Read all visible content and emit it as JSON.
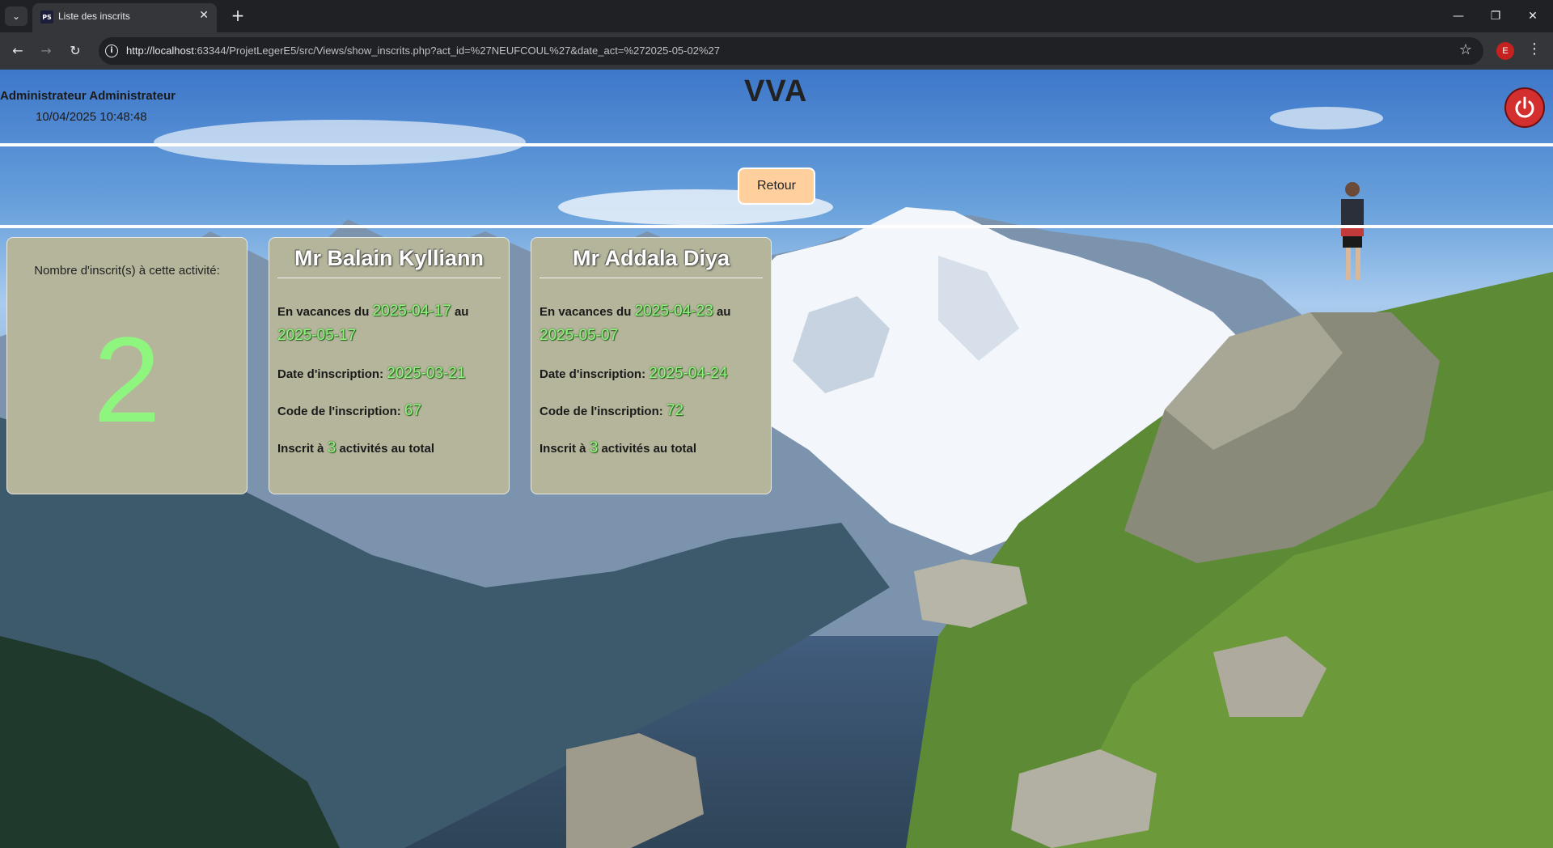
{
  "browser": {
    "tab_title": "Liste des inscrits",
    "tab_favicon": "PS",
    "url_host": "http://localhost",
    "url_rest": ":63344/ProjetLegerE5/src/Views/show_inscrits.php?act_id=%27NEUFCOUL%27&date_act=%272025-05-02%27",
    "profile_initial": "E"
  },
  "header": {
    "user_name": "Administrateur Administrateur",
    "datetime": "10/04/2025 10:48:48",
    "site_title": "VVA"
  },
  "retour_button": "Retour",
  "count_card": {
    "label": "Nombre d'inscrit(s) à cette activité:",
    "value": "2"
  },
  "inscrits": [
    {
      "name": "Mr Balain Kylliann",
      "vacances_prefix": "En vacances du",
      "vacances_from": "2025-04-17",
      "vacances_sep": "au",
      "vacances_to": "2025-05-17",
      "date_label": "Date d'inscription:",
      "date_value": "2025-03-21",
      "code_label": "Code de l'inscription:",
      "code_value": "67",
      "total_prefix": "Inscrit à",
      "total_value": "3",
      "total_suffix": "activités au total"
    },
    {
      "name": "Mr Addala Diya",
      "vacances_prefix": "En vacances du",
      "vacances_from": "2025-04-23",
      "vacances_sep": "au",
      "vacances_to": "2025-05-07",
      "date_label": "Date d'inscription:",
      "date_value": "2025-04-24",
      "code_label": "Code de l'inscription:",
      "code_value": "72",
      "total_prefix": "Inscrit à",
      "total_value": "3",
      "total_suffix": "activités au total"
    }
  ],
  "colors": {
    "highlight": "#8ef57e",
    "card_bg": "#b5b59b",
    "retour_bg": "#ffcf9e",
    "logout_bg": "#d32f2f"
  }
}
